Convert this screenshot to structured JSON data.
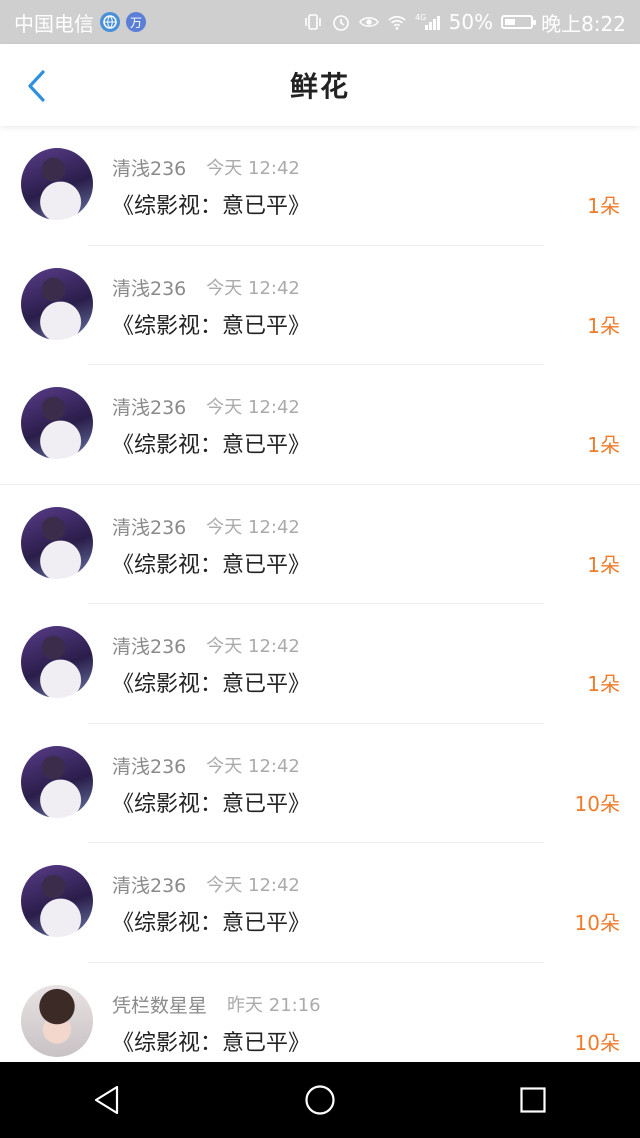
{
  "status_bar": {
    "carrier": "中国电信",
    "battery_percent": "50%",
    "battery_level": 0.5,
    "time": "晚上8:22",
    "network": "4G",
    "icons": [
      "browser-icon",
      "wan-icon",
      "vibrate-icon",
      "alarm-icon",
      "eye-icon",
      "wifi-icon",
      "signal-icon",
      "battery-icon"
    ]
  },
  "header": {
    "title": "鲜花",
    "back_icon": "chevron-left-icon",
    "accent": "#2f8fe0"
  },
  "colors": {
    "amount": "#f07b2a",
    "name": "#8a8a8a"
  },
  "records": [
    {
      "name": "清浅236",
      "time": "今天 12:42",
      "text": "《综影视：意已平》",
      "amount": "1朵",
      "avatar": "avatar-a"
    },
    {
      "name": "清浅236",
      "time": "今天 12:42",
      "text": "《综影视：意已平》",
      "amount": "1朵",
      "avatar": "avatar-a"
    },
    {
      "name": "清浅236",
      "time": "今天 12:42",
      "text": "《综影视：意已平》",
      "amount": "1朵",
      "avatar": "avatar-a"
    },
    {
      "name": "清浅236",
      "time": "今天 12:42",
      "text": "《综影视：意已平》",
      "amount": "1朵",
      "avatar": "avatar-a"
    },
    {
      "name": "清浅236",
      "time": "今天 12:42",
      "text": "《综影视：意已平》",
      "amount": "1朵",
      "avatar": "avatar-a"
    },
    {
      "name": "清浅236",
      "time": "今天 12:42",
      "text": "《综影视：意已平》",
      "amount": "10朵",
      "avatar": "avatar-a"
    },
    {
      "name": "清浅236",
      "time": "今天 12:42",
      "text": "《综影视：意已平》",
      "amount": "10朵",
      "avatar": "avatar-a"
    },
    {
      "name": "凭栏数星星",
      "time": "昨天 21:16",
      "text": "《综影视：意已平》",
      "amount": "10朵",
      "avatar": "avatar-b"
    }
  ],
  "nav_bar": {
    "buttons": [
      "back-triangle-icon",
      "home-circle-icon",
      "recents-square-icon"
    ]
  }
}
